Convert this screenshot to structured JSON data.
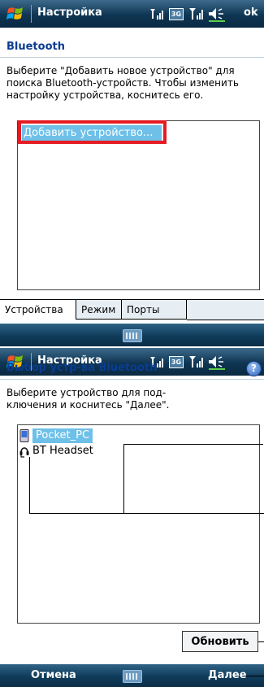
{
  "screen1": {
    "title": "Настройка",
    "ok": "ok",
    "network_badge": "3G",
    "header": "Bluetooth",
    "description": "Выберите \"Добавить новое устройство\" для поиска Bluetooth-устройств. Чтобы изменить настройку устройства, коснитесь его.",
    "list_item": "Добавить устройство...",
    "tabs": [
      "Устройства",
      "Режим",
      "Порты COM"
    ]
  },
  "screen2": {
    "title": "Настройка",
    "network_badge": "3G",
    "header": "Выбор устр-ва Bluetooth",
    "help": "?",
    "description": "Выберите устройство для под-ключения и коснитесь \"Далее\".",
    "devices": [
      "Pocket_PC",
      "BT Headset"
    ],
    "refresh": "Обновить",
    "left_softkey": "Отмена",
    "right_softkey": "Далее"
  },
  "colors": {
    "titlebar": "#0e3552",
    "accent": "#0b3d91",
    "selection": "#6ec0e8",
    "highlight_frame": "#e51b23"
  }
}
